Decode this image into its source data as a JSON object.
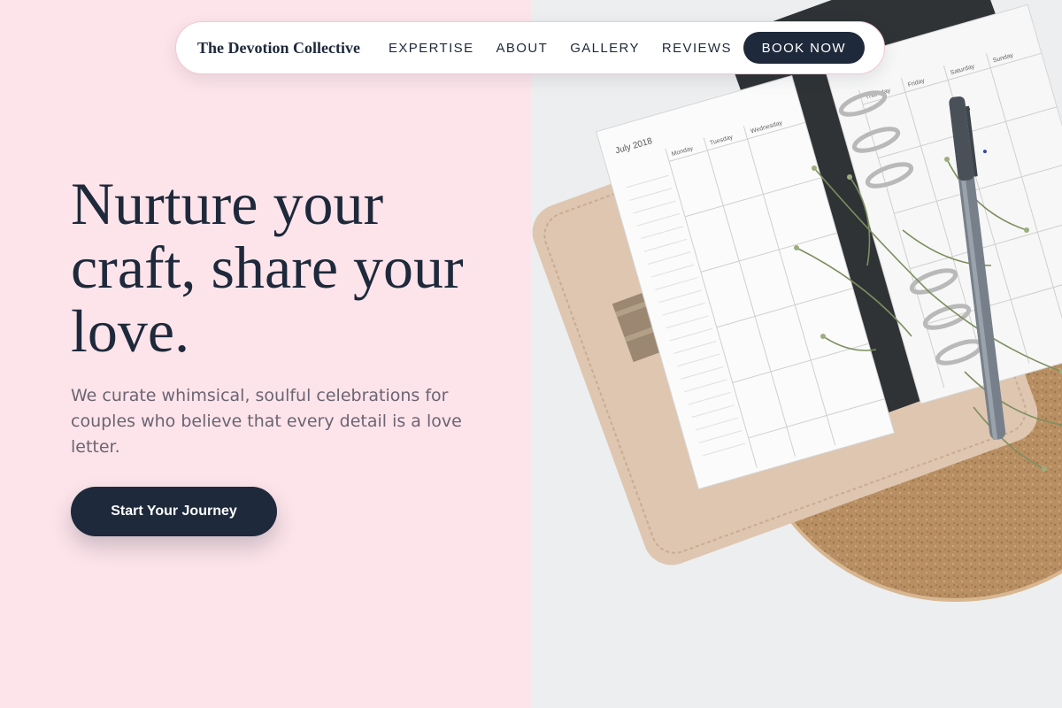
{
  "nav": {
    "brand": "The Devotion Collective",
    "links": [
      "EXPERTISE",
      "ABOUT",
      "GALLERY",
      "REVIEWS"
    ],
    "cta": "BOOK NOW"
  },
  "hero": {
    "title": "Nurture your craft, share your love.",
    "subtitle": "We curate whimsical, soulful celebrations for couples who believe that every detail is a love letter.",
    "cta": "Start Your Journey"
  },
  "photo": {
    "planner_month": "July 2018",
    "day_names": [
      "Monday",
      "Tuesday",
      "Wednesday",
      "Thursday",
      "Friday",
      "Saturday",
      "Sunday"
    ]
  },
  "colors": {
    "left_background": "#fde4ea",
    "navy": "#1e293b",
    "subtitle_text": "#6b6472"
  }
}
